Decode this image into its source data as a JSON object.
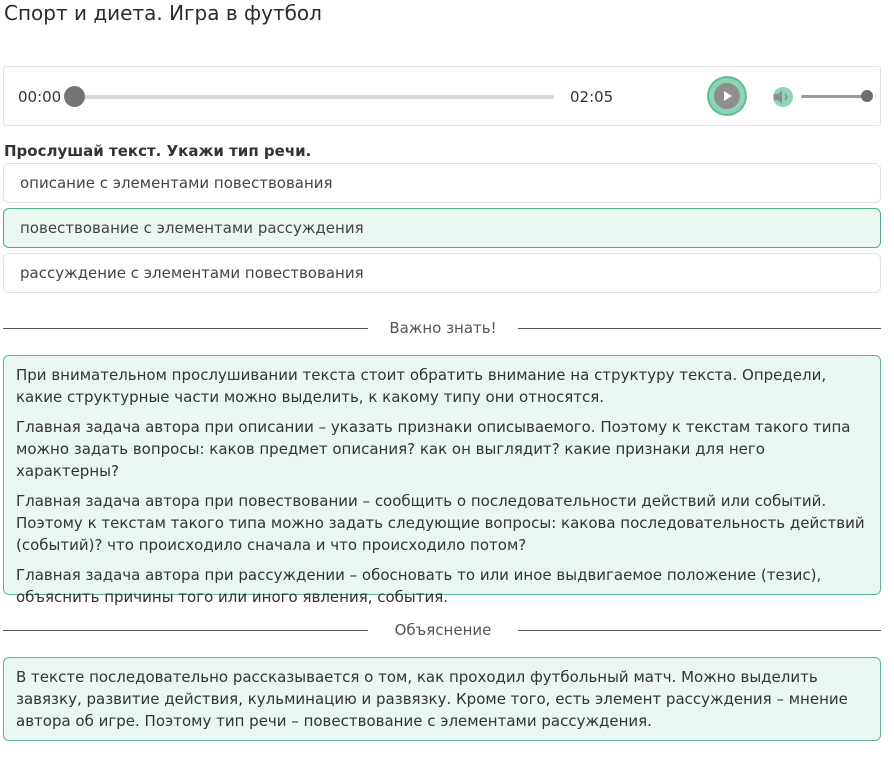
{
  "page": {
    "title": "Спорт и диета. Игра в футбол"
  },
  "player": {
    "current_time": "00:00",
    "total_time": "02:05",
    "progress": 0,
    "volume": 1.0,
    "play_icon": "play-icon",
    "volume_icon": "speaker-icon",
    "accent_color": "#5bbf93"
  },
  "question": {
    "text": "Прослушай текст. Укажи тип речи.",
    "options": [
      {
        "label": "описание с элементами повествования",
        "selected": false
      },
      {
        "label": "повествование с элементами рассуждения",
        "selected": true
      },
      {
        "label": "рассуждение с элементами повествования",
        "selected": false
      }
    ]
  },
  "important": {
    "heading": "Важно знать!",
    "paragraphs": [
      "При внимательном прослушивании текста стоит обратить внимание на структуру текста. Определи, какие структурные части можно выделить, к какому типу они относятся.",
      "Главная задача автора при описании – указать признаки описываемого. Поэтому к текстам такого типа можно задать вопросы: каков предмет описания? как он выглядит? какие признаки для него характерны?",
      "Главная задача автора при повествовании – сообщить о последовательности действий или событий. Поэтому к текстам такого типа можно задать следующие вопросы: какова последовательность действий (событий)? что происходило сначала и что происходило потом?",
      "Главная задача автора при рассуждении – обосновать то или иное выдвигаемое положение (тезис), объяснить причины того или иного явления, события."
    ]
  },
  "explanation": {
    "heading": "Объяснение",
    "text": "В тексте последовательно рассказывается о том, как проходил футбольный матч. Можно выделить завязку, развитие действия, кульминацию и развязку. Кроме того, есть элемент рассуждения – мнение автора об игре. Поэтому тип речи – повествование с элементами рассуждения."
  }
}
